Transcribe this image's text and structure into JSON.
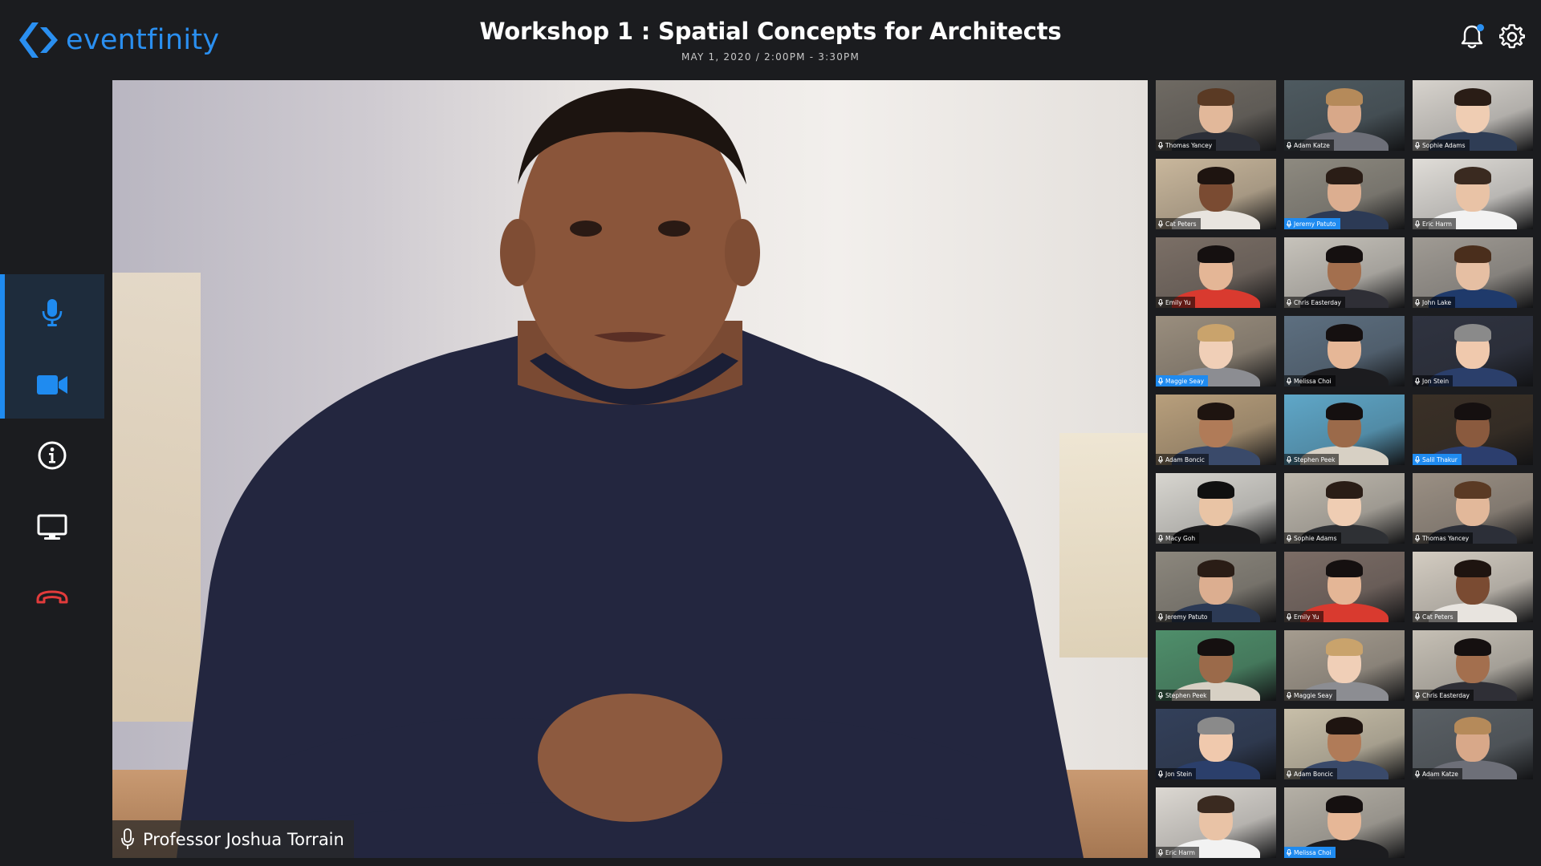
{
  "brand": {
    "name": "eventfinity",
    "color": "#2a8ff0"
  },
  "event": {
    "title": "Workshop 1 : Spatial Concepts for Architects",
    "datetime": "MAY 1, 2020 / 2:00PM - 3:30PM"
  },
  "header": {
    "icons": [
      "bell-icon",
      "gear-icon"
    ],
    "has_notification": true
  },
  "sidebar": {
    "items": [
      {
        "name": "microphone",
        "icon": "microphone-icon",
        "active": true
      },
      {
        "name": "camera",
        "icon": "video-camera-icon",
        "active": true
      },
      {
        "name": "info",
        "icon": "info-icon",
        "active": false
      },
      {
        "name": "screen-share",
        "icon": "monitor-icon",
        "active": false
      },
      {
        "name": "leave",
        "icon": "hang-up-icon",
        "active": false
      }
    ]
  },
  "speaker": {
    "name": "Professor Joshua Torrain"
  },
  "participants": [
    {
      "name": "Thomas Yancey",
      "active": false
    },
    {
      "name": "Adam Katze",
      "active": false
    },
    {
      "name": "Sophie Adams",
      "active": false
    },
    {
      "name": "Cat Peters",
      "active": false
    },
    {
      "name": "Jeremy Patuto",
      "active": true
    },
    {
      "name": "Eric Harm",
      "active": false
    },
    {
      "name": "Emily Yu",
      "active": false
    },
    {
      "name": "Chris Easterday",
      "active": false
    },
    {
      "name": "John Lake",
      "active": false
    },
    {
      "name": "Maggie Seay",
      "active": true
    },
    {
      "name": "Melissa Choi",
      "active": false
    },
    {
      "name": "Jon Stein",
      "active": false
    },
    {
      "name": "Adam Boncic",
      "active": false
    },
    {
      "name": "Stephen Peek",
      "active": false
    },
    {
      "name": "Salil Thakur",
      "active": true
    },
    {
      "name": "Macy Goh",
      "active": false
    },
    {
      "name": "Sophie Adams",
      "active": false
    },
    {
      "name": "Thomas Yancey",
      "active": false
    },
    {
      "name": "Jeremy Patuto",
      "active": false
    },
    {
      "name": "Emily Yu",
      "active": false
    },
    {
      "name": "Cat Peters",
      "active": false
    },
    {
      "name": "Stephen Peek",
      "active": false
    },
    {
      "name": "Maggie Seay",
      "active": false
    },
    {
      "name": "Chris Easterday",
      "active": false
    },
    {
      "name": "Jon Stein",
      "active": false
    },
    {
      "name": "Adam Boncic",
      "active": false
    },
    {
      "name": "Adam Katze",
      "active": false
    },
    {
      "name": "Eric Harm",
      "active": false
    },
    {
      "name": "Melissa Choi",
      "active": true
    }
  ]
}
